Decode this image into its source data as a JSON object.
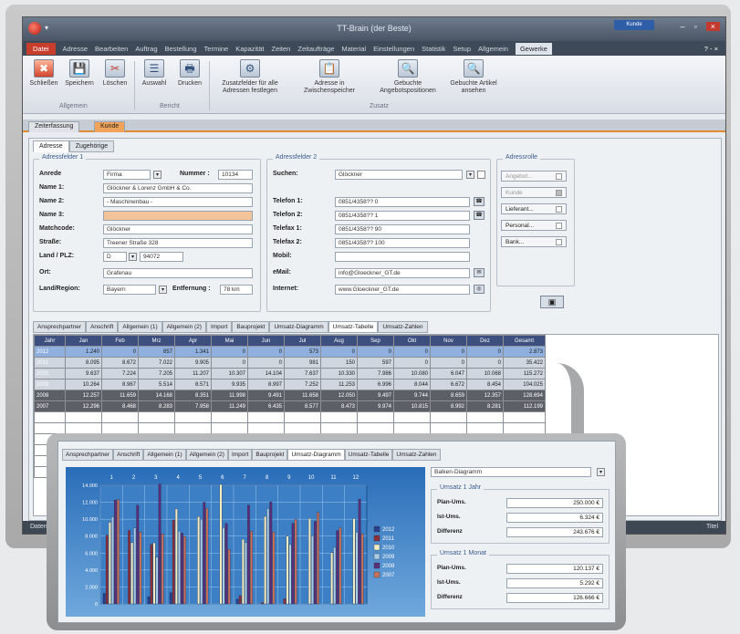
{
  "window": {
    "title": "TT-Brain (der Beste)",
    "context_tab": "Kunde"
  },
  "menu": {
    "items": [
      "Datei",
      "Adresse",
      "Bearbeiten",
      "Auftrag",
      "Bestellung",
      "Termine",
      "Kapazität",
      "Zeiten",
      "Zeitaufträge",
      "Material",
      "Einstellungen",
      "Statistik",
      "Setup",
      "Allgemein",
      "Gewerke"
    ],
    "right": "? - ×"
  },
  "ribbon": {
    "buttons": [
      {
        "label": "Schließen",
        "icon": "✖"
      },
      {
        "label": "Speichern",
        "icon": "💾"
      },
      {
        "label": "Löschen",
        "icon": "✂"
      },
      {
        "label": "Auswahl",
        "icon": "☰"
      },
      {
        "label": "Drucken",
        "icon": "🖶"
      },
      {
        "label": "Zusatzfelder für alle Adressen festlegen",
        "icon": "⚙"
      },
      {
        "label": "Adresse in Zwischenspeicher",
        "icon": "📋"
      },
      {
        "label": "Gebuchte Angebotspositionen",
        "icon": "🔍"
      },
      {
        "label": "Gebuchte Artikel ansehen",
        "icon": "🔍"
      }
    ],
    "groups": [
      "Allgemein",
      "Bericht",
      "Zusatz"
    ]
  },
  "doctabs": [
    "Zeiterfassung",
    "Kunde"
  ],
  "form_tabs": [
    "Adresse",
    "Zugehörige"
  ],
  "address1": {
    "title": "Adressfelder 1",
    "anrede_label": "Anrede",
    "anrede": "Firma",
    "nummer_label": "Nummer :",
    "nummer": "10134",
    "name1_label": "Name 1:",
    "name1": "Glöckner & Lorenz GmbH & Co.",
    "name2_label": "Name 2:",
    "name2": "- Maschinenbau -",
    "name3_label": "Name 3:",
    "name3": "",
    "matchcode_label": "Matchcode:",
    "matchcode": "Glöckner",
    "strasse_label": "Straße:",
    "strasse": "Treener Straße 328",
    "land_label": "Land / PLZ:",
    "land": "D",
    "plz": "94072",
    "ort_label": "Ort:",
    "ort": "Grafenau",
    "region_label": "Land/Region:",
    "region": "Bayern",
    "entfernung_label": "Entfernung :",
    "entfernung": "78 km"
  },
  "address2": {
    "title": "Adressfelder 2",
    "suchen_label": "Suchen:",
    "suchen": "Glöckner",
    "tel1_label": "Telefon 1:",
    "tel1": "0851/4358?? 0",
    "tel2_label": "Telefon 2:",
    "tel2": "0851/4358?? 1",
    "tel3_label": "Telefax 1:",
    "tel3": "0851/4358?? 90",
    "tel4_label": "Telefax 2:",
    "tel4": "0851/4358?? 100",
    "mobil_label": "Mobil:",
    "mobil": "",
    "email_label": "eMail:",
    "email": "info@Gloeckner_GT.de",
    "internet_label": "Internet:",
    "internet": "www.Gloeckner_GT.de"
  },
  "adressrolle": {
    "title": "Adressrolle",
    "items": [
      "Angebot...",
      "Kunde",
      "Lieferant...",
      "Personal...",
      "Bank..."
    ]
  },
  "subtabs": [
    "Ansprechpartner",
    "Anschrift",
    "Allgemein (1)",
    "Allgemein (2)",
    "Import",
    "Bauprojekt",
    "Umsatz-Diagramm",
    "Umsatz-Tabelle",
    "Umsatz-Zahlen"
  ],
  "table": {
    "headers": [
      "Jahr",
      "Jan",
      "Feb",
      "Mrz",
      "Apr",
      "Mai",
      "Jun",
      "Jul",
      "Aug",
      "Sep",
      "Okt",
      "Nov",
      "Dez",
      "Gesamt"
    ],
    "rows": [
      [
        "2012",
        "1.240",
        "0",
        "857",
        "1.341",
        "0",
        "0",
        "573",
        "0",
        "0",
        "0",
        "0",
        "0",
        "2.873"
      ],
      [
        "2011",
        "8.095",
        "8.672",
        "7.022",
        "9.905",
        "0",
        "0",
        "981",
        "150",
        "597",
        "0",
        "0",
        "0",
        "35.422"
      ],
      [
        "2010",
        "9.637",
        "7.224",
        "7.205",
        "11.207",
        "10.307",
        "14.104",
        "7.637",
        "10.330",
        "7.986",
        "10.080",
        "6.047",
        "10.068",
        "115.272"
      ],
      [
        "2009",
        "10.264",
        "8.967",
        "5.514",
        "8.571",
        "9.935",
        "8.997",
        "7.252",
        "11.253",
        "6.996",
        "8.044",
        "6.672",
        "8.454",
        "104.025"
      ],
      [
        "2008",
        "12.257",
        "11.659",
        "14.168",
        "8.351",
        "11.998",
        "9.491",
        "11.658",
        "12.050",
        "9.497",
        "9.744",
        "8.659",
        "12.357",
        "128.694"
      ],
      [
        "2007",
        "12.296",
        "8.468",
        "8.283",
        "7.958",
        "11.249",
        "6.435",
        "8.577",
        "8.473",
        "9.974",
        "10.815",
        "8.992",
        "8.281",
        "112.199"
      ]
    ]
  },
  "statusbar": {
    "left": "Datensatz",
    "right": "Titel"
  },
  "zoom": {
    "tabs": [
      "Ansprechpartner",
      "Anschrift",
      "Allgemein (1)",
      "Allgemein (2)",
      "Import",
      "Bauprojekt",
      "Umsatz-Diagramm",
      "Umsatz-Tabelle",
      "Umsatz-Zahlen"
    ],
    "chart_select": "Balken-Diagramm",
    "g1": {
      "title": "Umsatz 1 Jahr",
      "rows": [
        {
          "label": "Plan-Ums.",
          "value": "250.000 €"
        },
        {
          "label": "Ist-Ums.",
          "value": "6.324 €"
        },
        {
          "label": "Differenz",
          "value": "243.676 €"
        }
      ]
    },
    "g2": {
      "title": "Umsatz 1 Monat",
      "rows": [
        {
          "label": "Plan-Ums.",
          "value": "120.137 €"
        },
        {
          "label": "Ist-Ums.",
          "value": "5.292 €"
        },
        {
          "label": "Differenz",
          "value": "126.666 €"
        }
      ]
    }
  },
  "chart_data": {
    "type": "bar",
    "categories": [
      "1",
      "2",
      "3",
      "4",
      "5",
      "6",
      "7",
      "8",
      "9",
      "10",
      "11",
      "12"
    ],
    "ylim": [
      0,
      14000
    ],
    "yticks": [
      "14.000",
      "12.000",
      "10.000",
      "8.000",
      "6.000",
      "4.000",
      "2.000",
      "0"
    ],
    "series": [
      {
        "name": "2012",
        "color": "#2b3f8c",
        "values": [
          1240,
          0,
          857,
          1341,
          0,
          0,
          573,
          0,
          0,
          0,
          0,
          0
        ]
      },
      {
        "name": "2011",
        "color": "#8e2f3c",
        "values": [
          8095,
          8672,
          7022,
          9905,
          0,
          0,
          981,
          150,
          597,
          0,
          0,
          0
        ]
      },
      {
        "name": "2010",
        "color": "#f2ecc4",
        "values": [
          9637,
          7224,
          7205,
          11207,
          10307,
          14104,
          7637,
          10330,
          7986,
          10080,
          6047,
          10068
        ]
      },
      {
        "name": "2009",
        "color": "#a9cbe6",
        "values": [
          10264,
          8967,
          5514,
          8571,
          9935,
          8997,
          7252,
          11253,
          6996,
          8044,
          6672,
          8454
        ]
      },
      {
        "name": "2008",
        "color": "#5b2f7a",
        "values": [
          12257,
          11659,
          14168,
          8351,
          11998,
          9491,
          11658,
          12050,
          9497,
          9744,
          8659,
          12357
        ]
      },
      {
        "name": "2007",
        "color": "#c8725e",
        "values": [
          12296,
          8468,
          8283,
          7958,
          11249,
          6435,
          8577,
          8473,
          9974,
          10815,
          8992,
          8281
        ]
      }
    ],
    "grid": true,
    "legend": "right"
  }
}
